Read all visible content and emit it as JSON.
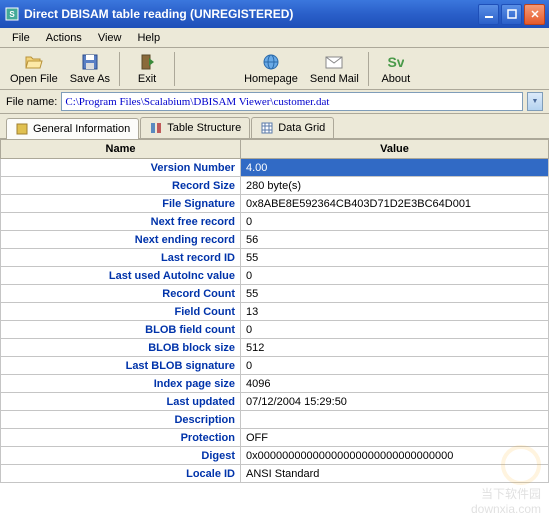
{
  "window": {
    "title": "Direct DBISAM table reading (UNREGISTERED)"
  },
  "menu": {
    "file": "File",
    "actions": "Actions",
    "view": "View",
    "help": "Help"
  },
  "toolbar": {
    "open_file": "Open File",
    "save_as": "Save As",
    "exit": "Exit",
    "homepage": "Homepage",
    "send_mail": "Send Mail",
    "about": "About"
  },
  "filename": {
    "label": "File name:",
    "value": "C:\\Program Files\\Scalabium\\DBISAM Viewer\\customer.dat"
  },
  "tabs": {
    "general": "General Information",
    "structure": "Table Structure",
    "grid": "Data Grid"
  },
  "table": {
    "header_name": "Name",
    "header_value": "Value",
    "rows": [
      {
        "name": "Version Number",
        "value": "4.00"
      },
      {
        "name": "Record Size",
        "value": "280 byte(s)"
      },
      {
        "name": "File Signature",
        "value": "0x8ABE8E592364CB403D71D2E3BC64D001"
      },
      {
        "name": "Next free record",
        "value": "0"
      },
      {
        "name": "Next ending record",
        "value": "56"
      },
      {
        "name": "Last record ID",
        "value": "55"
      },
      {
        "name": "Last used AutoInc value",
        "value": "0"
      },
      {
        "name": "Record Count",
        "value": "55"
      },
      {
        "name": "Field Count",
        "value": "13"
      },
      {
        "name": "BLOB field count",
        "value": "0"
      },
      {
        "name": "BLOB block size",
        "value": "512"
      },
      {
        "name": "Last BLOB signature",
        "value": "0"
      },
      {
        "name": "Index page size",
        "value": "4096"
      },
      {
        "name": "Last updated",
        "value": "07/12/2004 15:29:50"
      },
      {
        "name": "Description",
        "value": ""
      },
      {
        "name": "Protection",
        "value": "OFF"
      },
      {
        "name": "Digest",
        "value": "0x00000000000000000000000000000000"
      },
      {
        "name": "Locale ID",
        "value": "ANSI Standard"
      }
    ]
  },
  "watermark": {
    "text1": "当下软件园",
    "text2": "downxia.com"
  }
}
